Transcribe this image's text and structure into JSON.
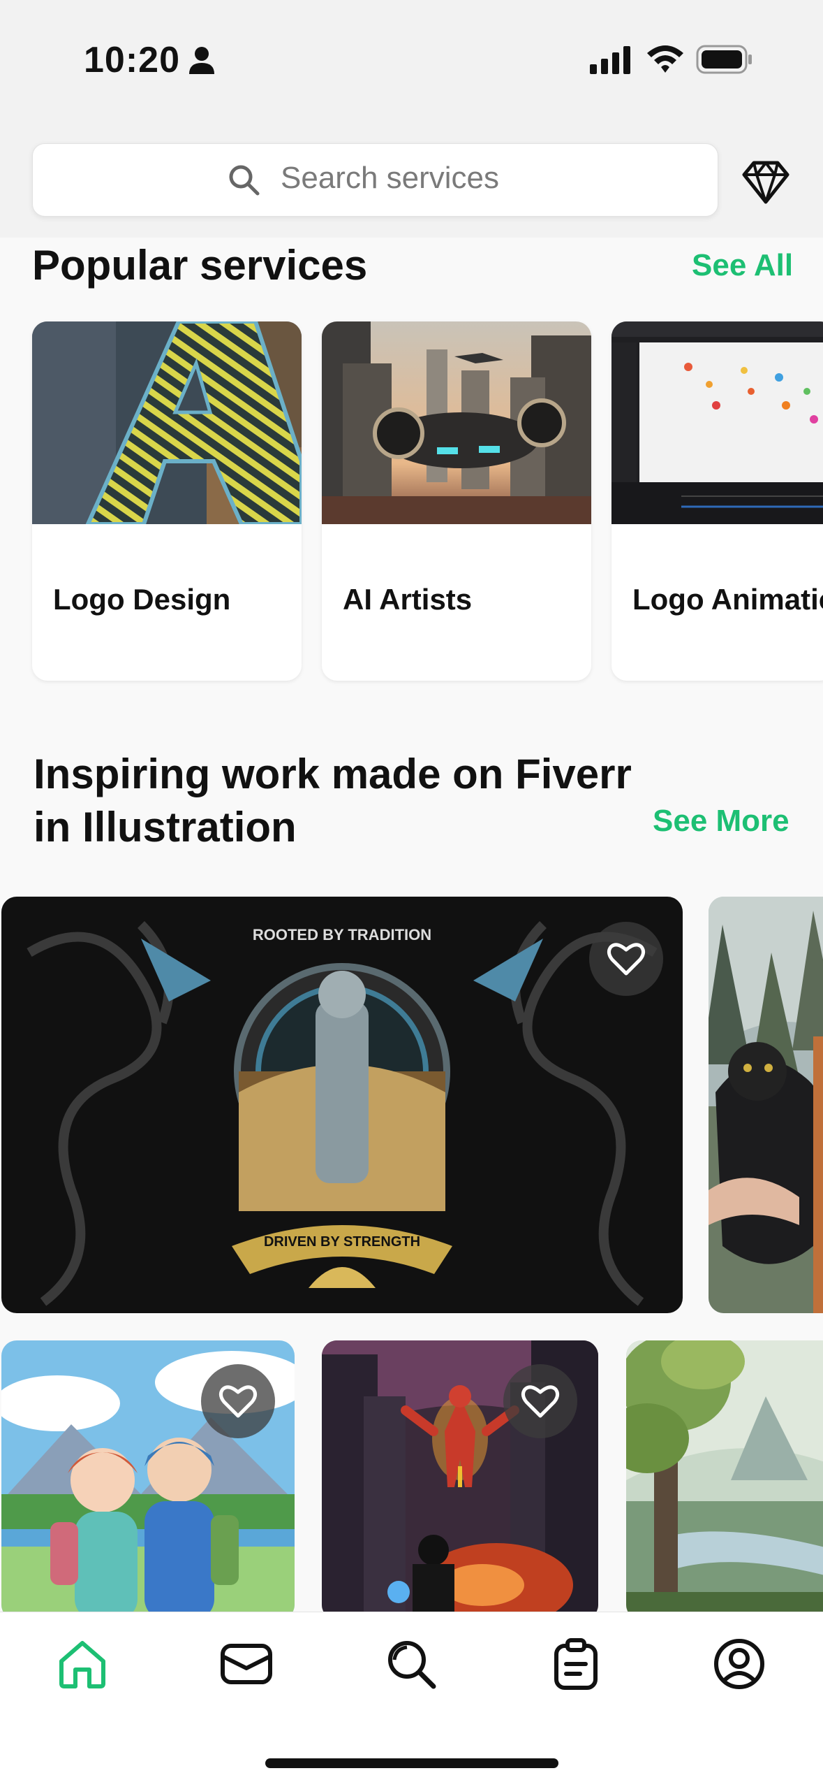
{
  "status_bar": {
    "time": "10:20"
  },
  "search": {
    "placeholder": "Search services"
  },
  "popular": {
    "title": "Popular services",
    "see_all": "See All",
    "cards": [
      {
        "label": "Logo Design"
      },
      {
        "label": "AI Artists"
      },
      {
        "label": "Logo Animation"
      }
    ]
  },
  "inspiring": {
    "title_line1": "Inspiring work made on Fiverr",
    "title_line2": "in Illustration",
    "see_more": "See More"
  },
  "colors": {
    "accent": "#1dbf73",
    "tab_active": "#1dbf73",
    "tab_inactive": "#111111"
  },
  "tabs": [
    {
      "icon": "home-icon",
      "active": true
    },
    {
      "icon": "mail-icon",
      "active": false
    },
    {
      "icon": "search-icon",
      "active": false
    },
    {
      "icon": "orders-icon",
      "active": false
    },
    {
      "icon": "profile-icon",
      "active": false
    }
  ]
}
